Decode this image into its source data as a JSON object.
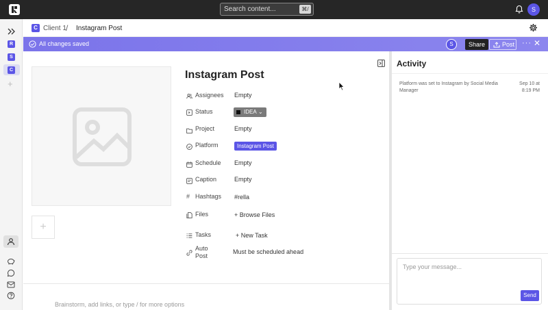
{
  "topbar": {
    "search_placeholder": "Search content...",
    "search_shortcut": "⌘/",
    "user_initial": "S"
  },
  "rail": {
    "workspaces": [
      {
        "label": "R"
      },
      {
        "label": "S"
      },
      {
        "label": "C"
      }
    ],
    "add": "+"
  },
  "breadcrumb": {
    "badge": "C",
    "client": "Client 1",
    "separator": "/",
    "current": "Instagram Post"
  },
  "statusbar": {
    "saved": "All changes saved",
    "avatar_initial": "S",
    "share": "Share",
    "post": "Post",
    "more": "···",
    "close": "✕"
  },
  "post": {
    "title": "Instagram Post",
    "add_media": "+",
    "properties": {
      "assignees": {
        "label": "Assignees",
        "value": "Empty"
      },
      "status": {
        "label": "Status",
        "value": "IDEA"
      },
      "project": {
        "label": "Project",
        "value": "Empty"
      },
      "platform": {
        "label": "Platform",
        "value": "Instagram Post"
      },
      "schedule": {
        "label": "Schedule",
        "value": "Empty"
      },
      "caption": {
        "label": "Caption",
        "value": "Empty"
      },
      "hashtags": {
        "label": "Hashtags",
        "value": "#rella"
      },
      "files": {
        "label": "Files",
        "value": "+ Browse Files"
      },
      "tasks": {
        "label": "Tasks",
        "value": "+ New Task"
      },
      "autopost": {
        "label_1": "Auto",
        "label_2": "Post",
        "value": "Must be scheduled ahead"
      }
    },
    "editor_placeholder": "Brainstorm, add links, or type / for more options"
  },
  "activity": {
    "title": "Activity",
    "entries": [
      {
        "text": "Platform was set to Instagram by Social Media Manager",
        "time": "Sep 10 at 8:19 PM"
      }
    ],
    "message_placeholder": "Type your message...",
    "send": "Send"
  },
  "colors": {
    "accent": "#5b55e6",
    "topbar": "#262626",
    "statusbar": "#7b74ea"
  }
}
